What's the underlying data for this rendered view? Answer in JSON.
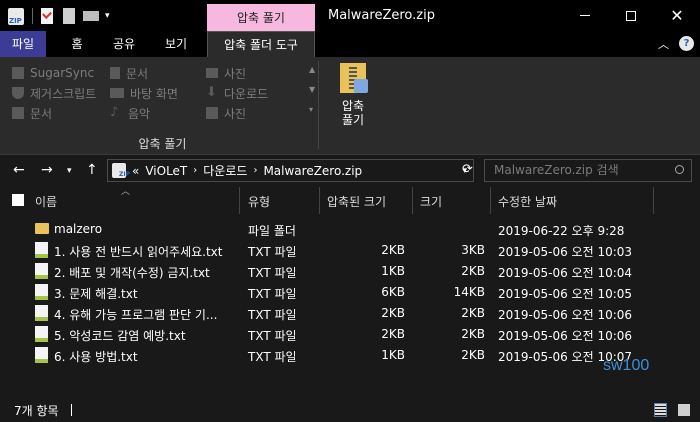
{
  "window": {
    "title": "MalwareZero.zip",
    "context_tab": "압축 풀기",
    "colors": {
      "file_tab": "#3c3c96",
      "context_tab": "#f7b8e0",
      "watermark": "#3f8fd6"
    }
  },
  "ribbon_tabs": [
    {
      "label": "파일"
    },
    {
      "label": "홈"
    },
    {
      "label": "공유"
    },
    {
      "label": "보기"
    },
    {
      "label": "압축 폴더 도구"
    }
  ],
  "ribbon": {
    "destinations": [
      {
        "label": "SugarSync",
        "icon": "folder-icon"
      },
      {
        "label": "문서",
        "icon": "document-icon"
      },
      {
        "label": "사진",
        "icon": "picture-icon"
      },
      {
        "label": "제거스크립트",
        "icon": "shield-icon"
      },
      {
        "label": "바탕 화면",
        "icon": "desktop-icon"
      },
      {
        "label": "다운로드",
        "icon": "download-icon"
      },
      {
        "label": "문서",
        "icon": "folder-icon"
      },
      {
        "label": "음악",
        "icon": "music-icon"
      },
      {
        "label": "사진",
        "icon": "folder-icon"
      }
    ],
    "group_label": "압축 풀기",
    "extract_all": {
      "line1": "압축",
      "line2": "풀기"
    }
  },
  "address": {
    "overflow": "«",
    "crumbs": [
      "ViOLeT",
      "다운로드",
      "MalwareZero.zip"
    ],
    "search_placeholder": "MalwareZero.zip 검색"
  },
  "columns": [
    "이름",
    "유형",
    "압축된 크기",
    "크기",
    "수정한 날짜"
  ],
  "files": [
    {
      "name": "malzero",
      "type": "파일 폴더",
      "packed": "",
      "size": "",
      "date": "2019-06-22 오후 9:28",
      "icon": "folder-icon"
    },
    {
      "name": "1. 사용 전 반드시 읽어주세요.txt",
      "type": "TXT 파일",
      "packed": "2KB",
      "size": "3KB",
      "date": "2019-05-06 오전 10:03",
      "icon": "txt-file-icon"
    },
    {
      "name": "2. 배포 및 개작(수정) 금지.txt",
      "type": "TXT 파일",
      "packed": "1KB",
      "size": "2KB",
      "date": "2019-05-06 오전 10:04",
      "icon": "txt-file-icon"
    },
    {
      "name": "3. 문제 해결.txt",
      "type": "TXT 파일",
      "packed": "6KB",
      "size": "14KB",
      "date": "2019-05-06 오전 10:05",
      "icon": "txt-file-icon"
    },
    {
      "name": "4. 유해 가능 프로그램 판단 기...",
      "type": "TXT 파일",
      "packed": "2KB",
      "size": "2KB",
      "date": "2019-05-06 오전 10:06",
      "icon": "txt-file-icon"
    },
    {
      "name": "5. 악성코드 감염 예방.txt",
      "type": "TXT 파일",
      "packed": "2KB",
      "size": "2KB",
      "date": "2019-05-06 오전 10:06",
      "icon": "txt-file-icon"
    },
    {
      "name": "6. 사용 방법.txt",
      "type": "TXT 파일",
      "packed": "1KB",
      "size": "2KB",
      "date": "2019-05-06 오전 10:07",
      "icon": "txt-file-icon"
    }
  ],
  "status": {
    "count": "7개 항목"
  },
  "watermark": "sw100"
}
